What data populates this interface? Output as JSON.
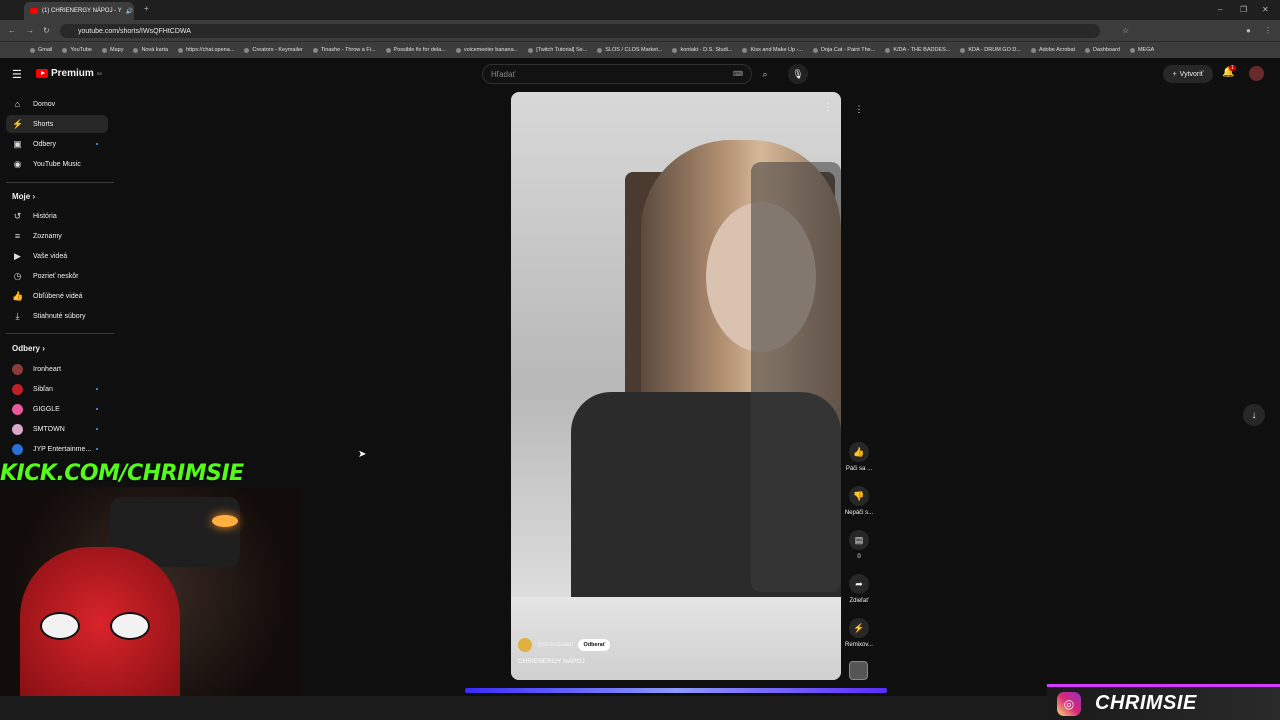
{
  "browser": {
    "tab_title": "(1) CHRIENERGY NÁPOJ - Y",
    "url": "youtube.com/shorts/IWsQFHtCDWA",
    "bookmarks": [
      "Gmail",
      "YouTube",
      "Mapy",
      "Nová karta",
      "https://chat.opena...",
      "Creators - Keymailer",
      "Tinashe - Throw a Fi...",
      "Possible fix for dela...",
      "voicemeeter banana...",
      "[Twitch Tutorial] Se...",
      "SLOS / CLOS Market...",
      "kontakt - D.S. Studi...",
      "Kiss and Make Up -...",
      "Doja Cat - Paint The...",
      "K/DA - THE BADDES...",
      "KDA - DRUM GO D...",
      "Adobe Acrobat",
      "Dashboard",
      "MEGA"
    ]
  },
  "masthead": {
    "logo": "Premium",
    "logo_region": "SK",
    "search_placeholder": "Hľadať",
    "create_label": "Vytvoriť",
    "notif_count": "1"
  },
  "sidebar": {
    "main": [
      {
        "label": "Domov",
        "icon": "home-icon"
      },
      {
        "label": "Shorts",
        "icon": "shorts-icon"
      },
      {
        "label": "Odbery",
        "icon": "subscriptions-icon"
      },
      {
        "label": "YouTube Music",
        "icon": "music-icon"
      }
    ],
    "you_title": "Moje",
    "you": [
      {
        "label": "História",
        "icon": "history-icon"
      },
      {
        "label": "Zoznamy",
        "icon": "playlists-icon"
      },
      {
        "label": "Vaše videá",
        "icon": "your-videos-icon"
      },
      {
        "label": "Pozrieť neskôr",
        "icon": "watch-later-icon"
      },
      {
        "label": "Obľúbené videá",
        "icon": "liked-icon"
      },
      {
        "label": "Stiahnuté súbory",
        "icon": "downloads-icon"
      }
    ],
    "subs_title": "Odbery",
    "subs": [
      {
        "label": "Ironheart",
        "color": "#8a3b3b"
      },
      {
        "label": "Sibľan",
        "color": "#c0202a"
      },
      {
        "label": "GIGGLE",
        "color": "#e85a9a"
      },
      {
        "label": "SMTOWN",
        "color": "#d8a8c8"
      },
      {
        "label": "JYP Entertainme...",
        "color": "#2a6fd6"
      }
    ]
  },
  "short": {
    "channel": "@slnieckaaar",
    "subscribe_label": "Odberať",
    "title": "CHRIENERGY NÁPOJ",
    "actions": [
      {
        "label": "Páči sa ...",
        "icon": "thumb-up-icon"
      },
      {
        "label": "Nepáči s...",
        "icon": "thumb-down-icon"
      },
      {
        "label": "0",
        "icon": "comment-icon"
      },
      {
        "label": "Zdieľať",
        "icon": "share-icon"
      },
      {
        "label": "Remixov...",
        "icon": "remix-icon"
      }
    ]
  },
  "overlay": {
    "kick_text": "KICK.COM/CHRIMSIE",
    "brand_name": "CHRIMSIE"
  }
}
